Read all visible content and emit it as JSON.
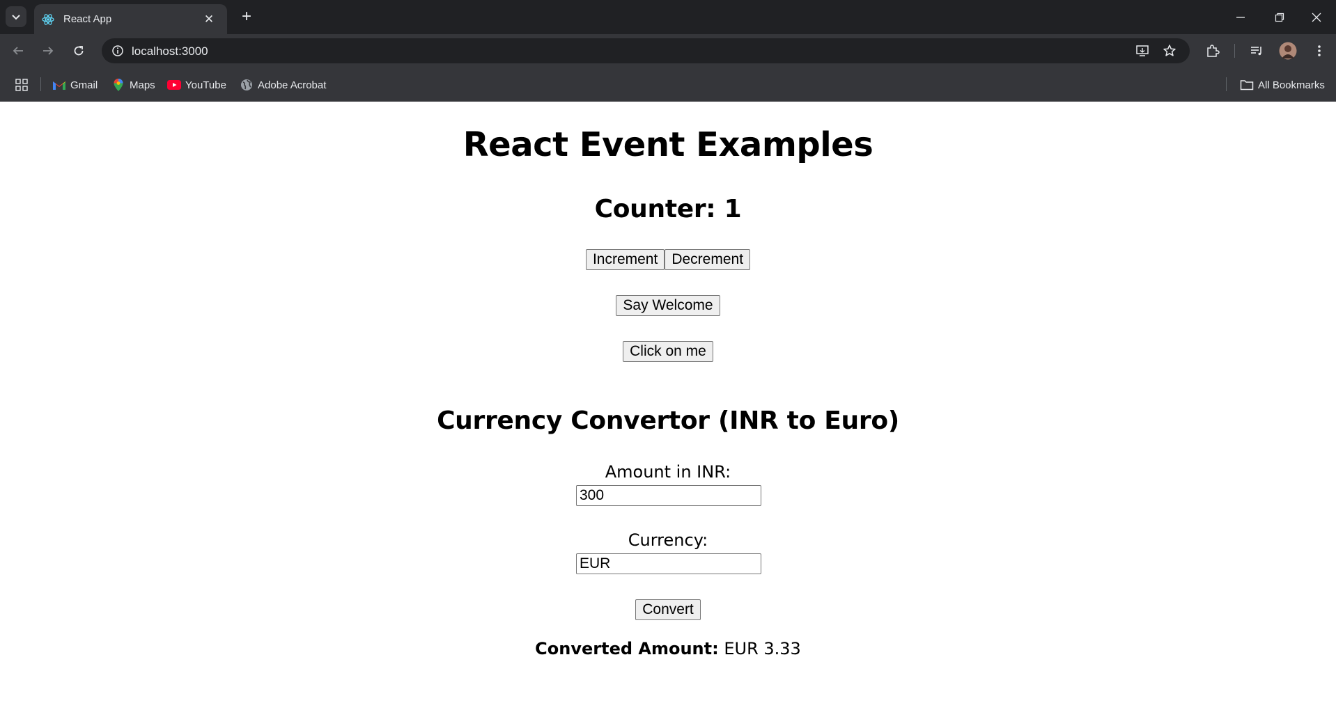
{
  "browser": {
    "tab_title": "React App",
    "url": "localhost:3000",
    "bookmarks": [
      {
        "label": "Gmail",
        "icon": "gmail-icon"
      },
      {
        "label": "Maps",
        "icon": "maps-icon"
      },
      {
        "label": "YouTube",
        "icon": "youtube-icon"
      },
      {
        "label": "Adobe Acrobat",
        "icon": "globe-icon"
      }
    ],
    "all_bookmarks": "All Bookmarks"
  },
  "page": {
    "title": "React Event Examples",
    "counter_label": "Counter: 1",
    "increment_label": "Increment",
    "decrement_label": "Decrement",
    "welcome_label": "Say Welcome",
    "click_label": "Click on me",
    "converter_title": "Currency Convertor (INR to Euro)",
    "amount_label": "Amount in INR:",
    "amount_value": "300",
    "currency_label": "Currency:",
    "currency_value": "EUR",
    "convert_label": "Convert",
    "result_label": "Converted Amount:",
    "result_value": "EUR 3.33"
  }
}
